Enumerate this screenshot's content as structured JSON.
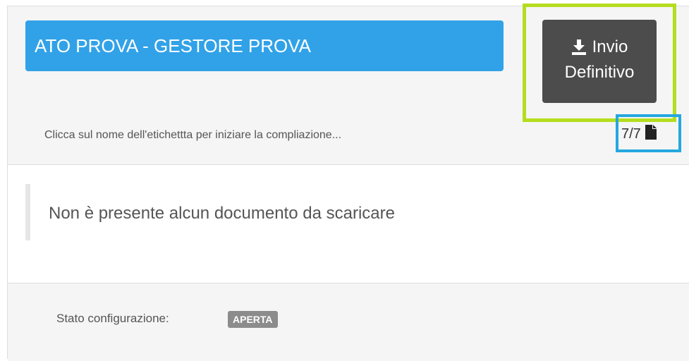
{
  "header": {
    "title": "ATO PROVA - GESTORE PROVA",
    "send_button": {
      "line1": "Invio",
      "line2": "Definitivo",
      "icon": "download-icon"
    },
    "hint": "Clicca sul nome dell'etichettta per iniziare la compliazione...",
    "counter": {
      "text": "7/7",
      "icon": "document-icon"
    }
  },
  "main": {
    "empty_message": "Non è presente alcun documento da scaricare"
  },
  "footer": {
    "status_label": "Stato configurazione:",
    "status_value": "APERTA"
  },
  "colors": {
    "title_bg": "#31a2e8",
    "button_bg": "#4c4c4c",
    "highlight_green": "#b5dd1e",
    "highlight_blue": "#25a8e0",
    "badge_bg": "#8c8c8c"
  }
}
